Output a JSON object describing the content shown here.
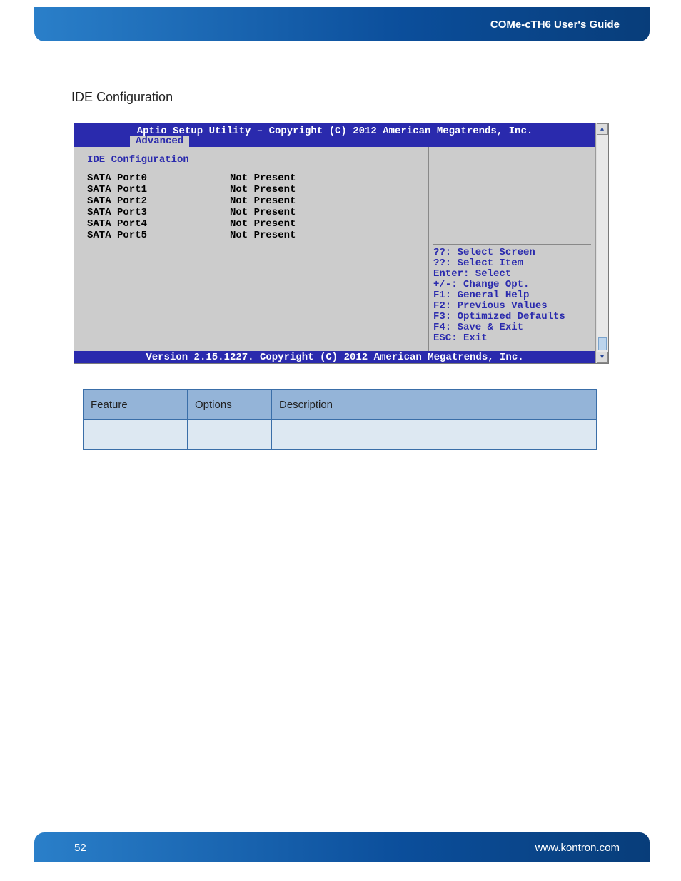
{
  "header": {
    "title": "COMe-cTH6 User's Guide"
  },
  "section": {
    "title": "IDE Configuration"
  },
  "bios": {
    "title": "Aptio Setup Utility – Copyright (C) 2012 American Megatrends, Inc.",
    "tab": "Advanced",
    "heading": "IDE Configuration",
    "ports": [
      {
        "label": "SATA Port0",
        "status": "Not Present"
      },
      {
        "label": "SATA Port1",
        "status": "Not Present"
      },
      {
        "label": "SATA Port2",
        "status": "Not Present"
      },
      {
        "label": "SATA Port3",
        "status": "Not Present"
      },
      {
        "label": "SATA Port4",
        "status": "Not Present"
      },
      {
        "label": "SATA Port5",
        "status": "Not Present"
      }
    ],
    "help": [
      "??: Select Screen",
      "??: Select Item",
      "Enter: Select",
      "+/-: Change Opt.",
      "F1: General Help",
      "F2: Previous Values",
      "F3: Optimized Defaults",
      "F4: Save & Exit",
      "ESC: Exit"
    ],
    "footer": "Version 2.15.1227. Copyright (C) 2012 American Megatrends, Inc."
  },
  "table": {
    "headers": {
      "feature": "Feature",
      "options": "Options",
      "description": "Description"
    },
    "rows": [
      {
        "feature": "",
        "options": "",
        "description": ""
      }
    ]
  },
  "footer": {
    "page": "52",
    "url": "www.kontron.com"
  }
}
